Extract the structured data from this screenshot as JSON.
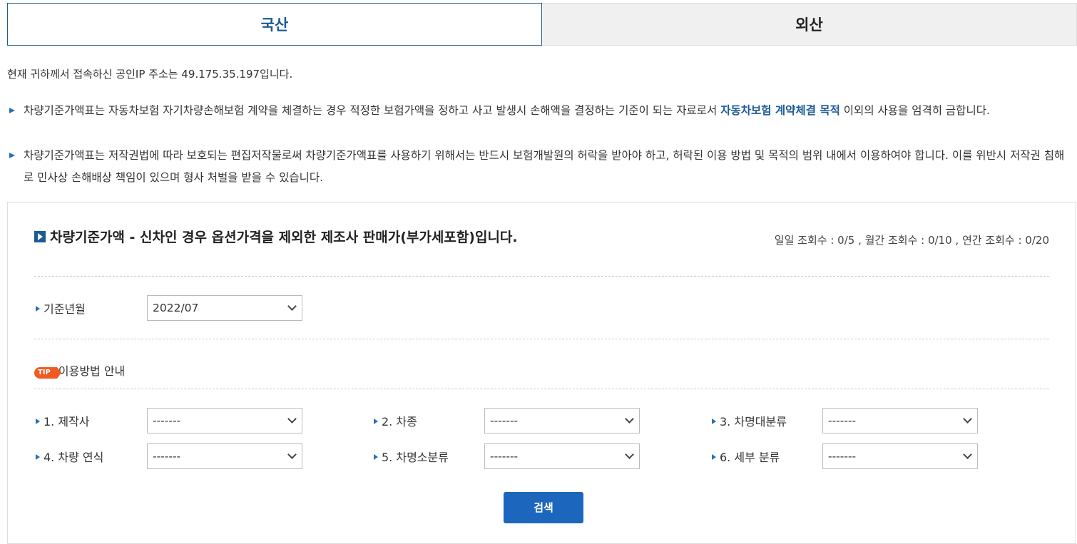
{
  "tabs": [
    {
      "label": "국산",
      "active": true
    },
    {
      "label": "외산",
      "active": false
    }
  ],
  "ip_notice": "현재 귀하께서 접속하신 공인IP 주소는 49.175.35.197입니다.",
  "notices": [
    {
      "pre": "차량기준가액표는 자동차보험 자기차량손해보험 계약을 체결하는 경우 적정한 보험가액을 정하고 사고 발생시 손해액을 결정하는 기준이 되는 자료로서 ",
      "highlight": "자동차보험 계약체결 목적",
      "post": " 이외의 사용을 엄격히 금합니다."
    },
    {
      "pre": "차량기준가액표는 저작권법에 따라 보호되는 편집저작물로써 차량기준가액표를 사용하기 위해서는 반드시 보험개발원의 허락을 받아야 하고, 허락된 이용 방법 및 목적의 범위 내에서 이용하여야 합니다. 이를 위반시 저작권 침해로 민사상 손해배상 책임이 있으며 형사 처벌을 받을 수 있습니다.",
      "highlight": "",
      "post": ""
    }
  ],
  "panel": {
    "title": "차량기준가액 - 신차인 경우 옵션가격을 제외한 제조사 판매가(부가세포함)입니다.",
    "view_counts": "일일 조회수 : 0/5 , 월간 조회수 : 0/10 , 연간 조회수 : 0/20",
    "base_month": {
      "label": "기준년월",
      "value": "2022/07"
    },
    "tip": {
      "badge": "TIP",
      "label": "이용방법 안내"
    },
    "filters": [
      {
        "label": "1. 제작사",
        "value": "-------"
      },
      {
        "label": "2. 차종",
        "value": "-------"
      },
      {
        "label": "3. 차명대분류",
        "value": "-------"
      },
      {
        "label": "4. 차량 연식",
        "value": "-------"
      },
      {
        "label": "5. 차명소분류",
        "value": "-------"
      },
      {
        "label": "6. 세부 분류",
        "value": "-------"
      }
    ],
    "search_label": "검색"
  },
  "colors": {
    "accent": "#1c5a95",
    "button": "#1c67bd",
    "tip": "#f15a22"
  }
}
